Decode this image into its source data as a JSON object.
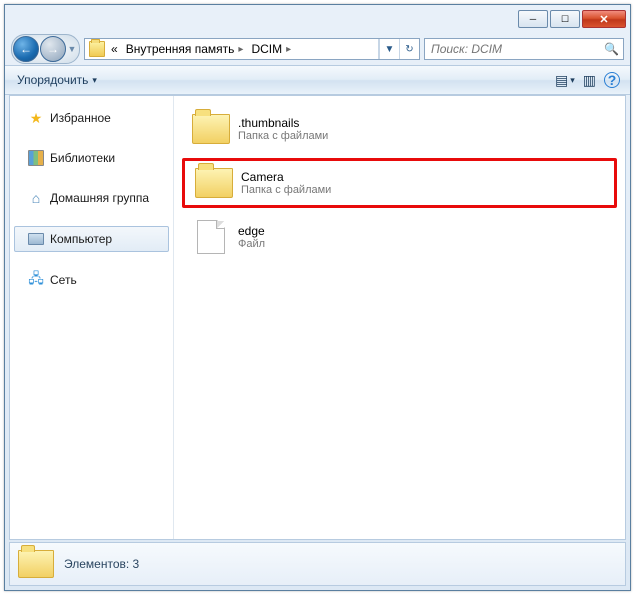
{
  "titlebar": {
    "minimize_glyph": "─",
    "maximize_glyph": "☐",
    "close_glyph": "✕"
  },
  "address": {
    "crumbs": [
      "«",
      "Внутренняя память",
      "DCIM"
    ],
    "refresh_glyph": "↻"
  },
  "search": {
    "placeholder": "Поиск: DCIM"
  },
  "toolbar": {
    "organize_label": "Упорядочить",
    "dropdown_glyph": "▾",
    "view_glyph": "▤",
    "preview_glyph": "▥",
    "help_glyph": "?"
  },
  "sidebar": {
    "items": [
      {
        "label": "Избранное",
        "icon": "star"
      },
      {
        "label": "Библиотеки",
        "icon": "lib"
      },
      {
        "label": "Домашняя группа",
        "icon": "home"
      },
      {
        "label": "Компьютер",
        "icon": "comp",
        "selected": true
      },
      {
        "label": "Сеть",
        "icon": "net"
      }
    ]
  },
  "items": [
    {
      "name": ".thumbnails",
      "sub": "Папка с файлами",
      "type": "folder",
      "highlight": false
    },
    {
      "name": "Camera",
      "sub": "Папка с файлами",
      "type": "folder",
      "highlight": true
    },
    {
      "name": "edge",
      "sub": "Файл",
      "type": "file",
      "highlight": false
    }
  ],
  "status": {
    "text": "Элементов: 3"
  }
}
